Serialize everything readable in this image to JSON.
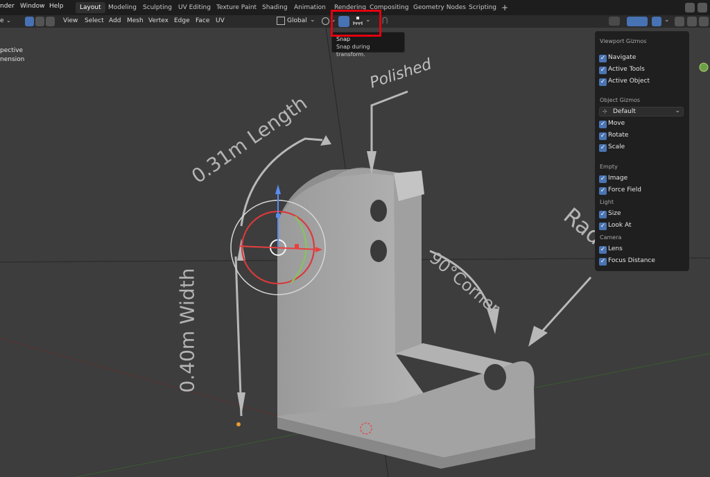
{
  "menu_bar": {
    "items": [
      "nder",
      "Window",
      "Help"
    ],
    "workspace_tabs": [
      "Layout",
      "Modeling",
      "Sculpting",
      "UV Editing",
      "Texture Paint",
      "Shading",
      "Animation",
      "Rendering",
      "Compositing",
      "Geometry Nodes",
      "Scripting"
    ],
    "active_tab": "Layout",
    "add_tab": "+"
  },
  "header": {
    "mode_fragment": "e",
    "menus": [
      "View",
      "Select",
      "Add",
      "Mesh",
      "Vertex",
      "Edge",
      "Face",
      "UV"
    ],
    "transform_orientation": "Global"
  },
  "tooltip": {
    "title": "Snap",
    "description": "Snap during transform."
  },
  "overlay_text": {
    "view_line1": "pective",
    "view_line2": "nension"
  },
  "gizmo_panel": {
    "sections": [
      {
        "heading": "Viewport Gizmos",
        "items": [
          {
            "label": "Navigate",
            "checked": true
          },
          {
            "label": "Active Tools",
            "checked": true
          },
          {
            "label": "Active Object",
            "checked": true
          }
        ]
      },
      {
        "heading": "Object Gizmos",
        "dropdown": "Default",
        "items": [
          {
            "label": "Move",
            "checked": true
          },
          {
            "label": "Rotate",
            "checked": true
          },
          {
            "label": "Scale",
            "checked": true
          }
        ]
      },
      {
        "heading": "Empty",
        "items": [
          {
            "label": "Image",
            "checked": true
          },
          {
            "label": "Force Field",
            "checked": true
          }
        ]
      },
      {
        "heading": "Light",
        "items": [
          {
            "label": "Size",
            "checked": true
          },
          {
            "label": "Look At",
            "checked": true
          }
        ]
      },
      {
        "heading": "Camera",
        "items": [
          {
            "label": "Lens",
            "checked": true
          },
          {
            "label": "Focus Distance",
            "checked": true
          }
        ]
      }
    ]
  },
  "scene_text": {
    "length": "0.31m Length",
    "width": "0.40m Width",
    "polished": "Polished",
    "corner": "90°Corner",
    "radius": "Radius"
  },
  "colors": {
    "accent_blue": "#4772b3",
    "highlight_red": "#e3000f",
    "topbar_bg": "#1d1d1d",
    "header_bg": "#2b2b2b",
    "viewport_bg": "#3d3d3d"
  }
}
